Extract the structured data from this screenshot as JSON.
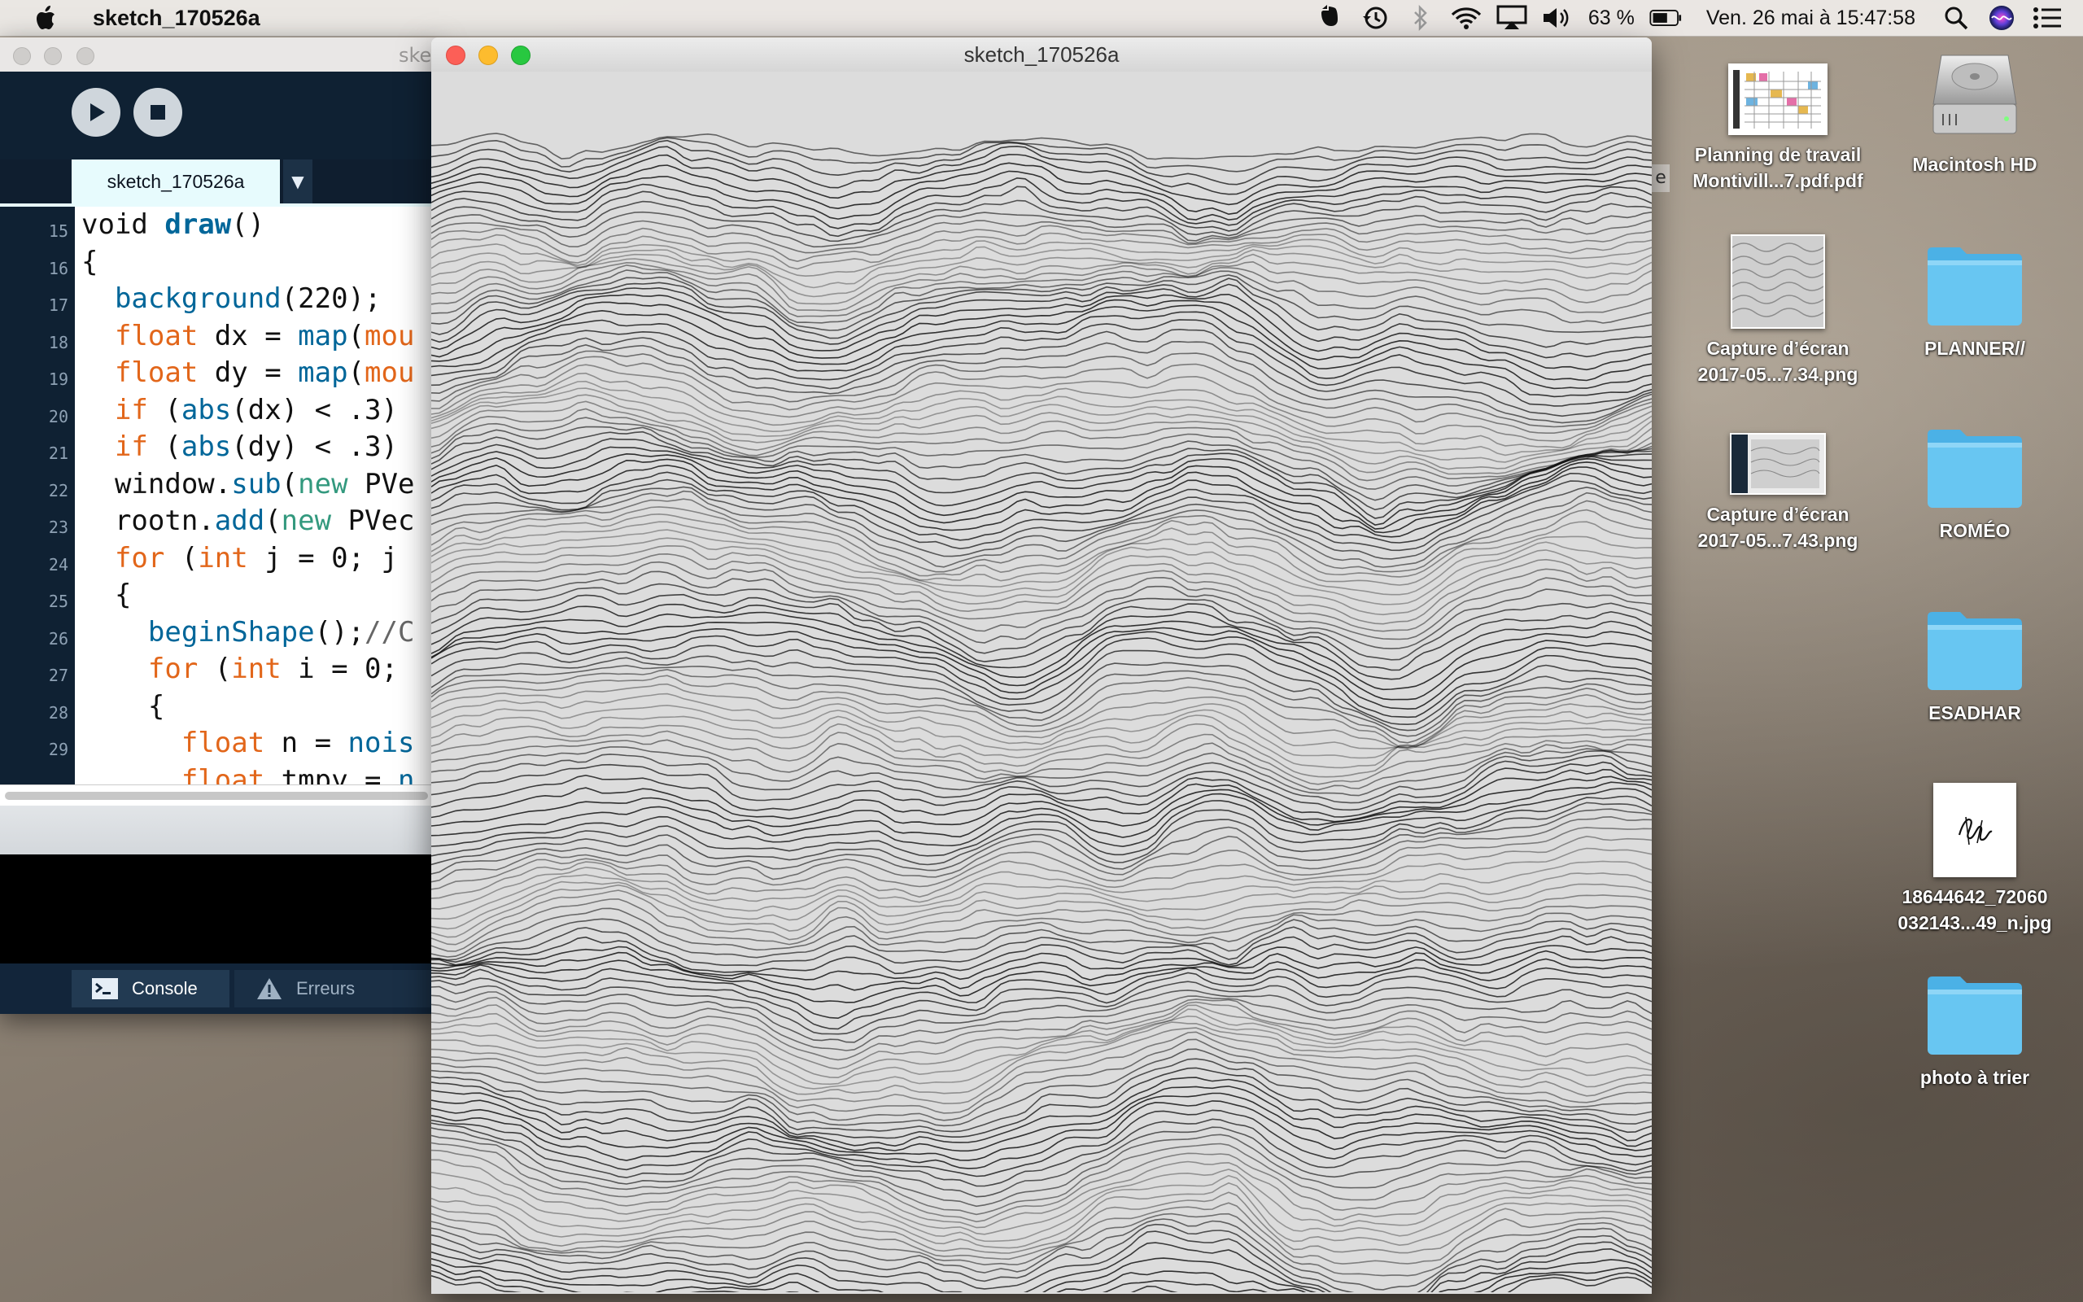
{
  "menubar": {
    "app_name": "sketch_170526a",
    "battery": "63 %",
    "datetime": "Ven. 26 mai à  15:47:58",
    "icons": [
      "apple-icon",
      "evernote-icon",
      "time-machine-icon",
      "bluetooth-icon",
      "wifi-icon",
      "airplay-icon",
      "volume-icon",
      "battery-icon",
      "spotlight-icon",
      "siri-icon",
      "notification-center-icon"
    ]
  },
  "ide": {
    "title": "ske",
    "tab_label": "sketch_170526a",
    "tab_arrow": "▼",
    "line_numbers": [
      "15",
      "16",
      "17",
      "18",
      "19",
      "20",
      "21",
      "22",
      "23",
      "24",
      "25",
      "26",
      "27",
      "28",
      "29"
    ],
    "console_label": "Console",
    "errors_label": "Erreurs",
    "code": [
      [
        [
          "void ",
          ""
        ],
        [
          "draw",
          "b"
        ],
        [
          "()",
          ""
        ]
      ],
      [
        [
          "{",
          ""
        ]
      ],
      [
        [
          "  ",
          ""
        ],
        [
          "background",
          "f"
        ],
        [
          "(220);",
          ""
        ]
      ],
      [
        [
          "  ",
          ""
        ],
        [
          "float",
          "t"
        ],
        [
          " dx = ",
          ""
        ],
        [
          "map",
          "f"
        ],
        [
          "(",
          ""
        ],
        [
          "mou",
          "t"
        ]
      ],
      [
        [
          "  ",
          ""
        ],
        [
          "float",
          "t"
        ],
        [
          " dy = ",
          ""
        ],
        [
          "map",
          "f"
        ],
        [
          "(",
          ""
        ],
        [
          "mou",
          "t"
        ]
      ],
      [
        [
          "  ",
          ""
        ],
        [
          "if",
          "t"
        ],
        [
          " (",
          ""
        ],
        [
          "abs",
          "f"
        ],
        [
          "(dx) < .3)",
          ""
        ]
      ],
      [
        [
          "  ",
          ""
        ],
        [
          "if",
          "t"
        ],
        [
          " (",
          ""
        ],
        [
          "abs",
          "f"
        ],
        [
          "(dy) < .3)",
          ""
        ]
      ],
      [
        [
          "  window.",
          ""
        ],
        [
          "sub",
          "f"
        ],
        [
          "(",
          ""
        ],
        [
          "new",
          "k"
        ],
        [
          " PVe",
          ""
        ]
      ],
      [
        [
          "  rootn.",
          ""
        ],
        [
          "add",
          "f"
        ],
        [
          "(",
          ""
        ],
        [
          "new",
          "k"
        ],
        [
          " PVec",
          ""
        ]
      ],
      [
        [
          "  ",
          ""
        ],
        [
          "for",
          "t"
        ],
        [
          " (",
          ""
        ],
        [
          "int",
          "t"
        ],
        [
          " j = 0; j",
          ""
        ]
      ],
      [
        [
          "  {",
          ""
        ]
      ],
      [
        [
          "    ",
          ""
        ],
        [
          "beginShape",
          "f"
        ],
        [
          "();",
          ""
        ],
        [
          "//C",
          "cm"
        ]
      ],
      [
        [
          "    ",
          ""
        ],
        [
          "for",
          "t"
        ],
        [
          " (",
          ""
        ],
        [
          "int",
          "t"
        ],
        [
          " i = 0;",
          ""
        ]
      ],
      [
        [
          "    {",
          ""
        ]
      ],
      [
        [
          "      ",
          ""
        ],
        [
          "float",
          "t"
        ],
        [
          " n = ",
          ""
        ],
        [
          "nois",
          "f"
        ]
      ],
      [
        [
          "      ",
          ""
        ],
        [
          "float",
          "t"
        ],
        [
          " tmpy = ",
          ""
        ],
        [
          "n",
          "f"
        ]
      ]
    ]
  },
  "sketch_window": {
    "title": "sketch_170526a",
    "canvas_background": "#dcdcdc",
    "stroke_color": "#111111"
  },
  "desktop": {
    "edge_letter": "e",
    "icons": [
      {
        "name": "planning-pdf",
        "line1": "Planning de travail",
        "line2": "Montivill...7.pdf.pdf"
      },
      {
        "name": "macintosh-hd",
        "line1": "Macintosh HD",
        "line2": ""
      },
      {
        "name": "capture-1",
        "line1": "Capture d’écran",
        "line2": "2017-05...7.34.png"
      },
      {
        "name": "planner-folder",
        "line1": "PLANNER//",
        "line2": ""
      },
      {
        "name": "capture-2",
        "line1": "Capture d’écran",
        "line2": "2017-05...7.43.png"
      },
      {
        "name": "romeo-folder",
        "line1": "ROMÉO",
        "line2": ""
      },
      {
        "name": "esadhar-folder",
        "line1": "ESADHAR",
        "line2": ""
      },
      {
        "name": "jpg-file",
        "line1": "18644642_72060",
        "line2": "032143...49_n.jpg"
      },
      {
        "name": "photo-folder",
        "line1": "photo à trier",
        "line2": ""
      }
    ]
  },
  "colors": {
    "menubar_bg": "#ecE9E6",
    "ide_bg": "#0f2133",
    "tab_bg": "#e7fbfd",
    "folder_blue": "#5ec1f0",
    "traffic_red": "#fc5f57",
    "traffic_yellow": "#fdbc2e",
    "traffic_green": "#28c840"
  }
}
